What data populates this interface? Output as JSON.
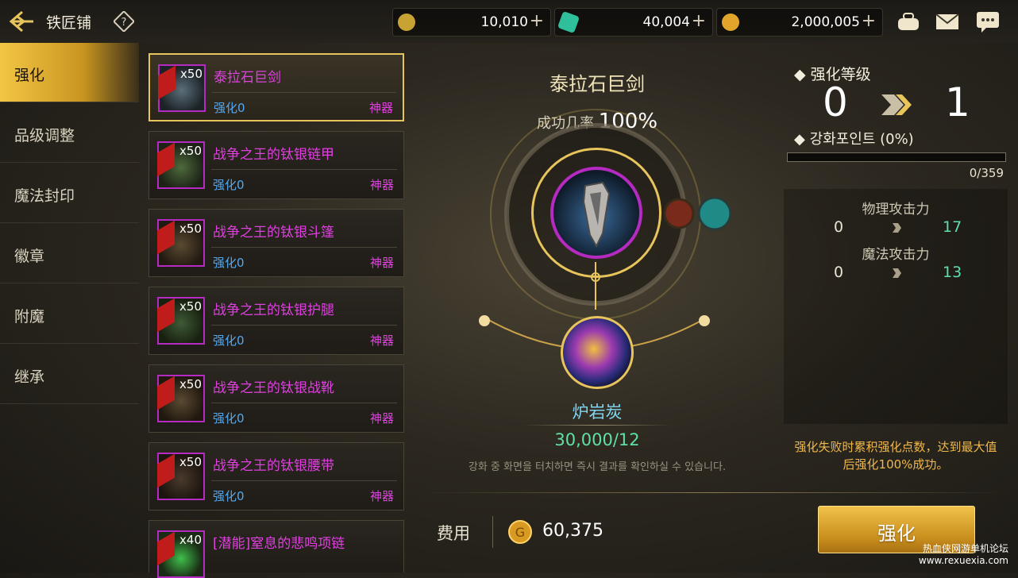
{
  "header": {
    "title": "铁匠铺",
    "resources": [
      {
        "name": "c-token",
        "value": "10,010"
      },
      {
        "name": "crystal",
        "value": "40,004"
      },
      {
        "name": "gold",
        "value": "2,000,005"
      }
    ]
  },
  "menu": {
    "items": [
      {
        "label": "强化",
        "active": true
      },
      {
        "label": "品级调整",
        "active": false
      },
      {
        "label": "魔法封印",
        "active": false
      },
      {
        "label": "徽章",
        "active": false
      },
      {
        "label": "附魔",
        "active": false
      },
      {
        "label": "继承",
        "active": false
      }
    ]
  },
  "items": [
    {
      "name": "泰拉石巨剑",
      "level": "强化0",
      "grade": "神器",
      "qty": "x50",
      "selected": true
    },
    {
      "name": "战争之王的钛银链甲",
      "level": "强化0",
      "grade": "神器",
      "qty": "x50",
      "selected": false
    },
    {
      "name": "战争之王的钛银斗篷",
      "level": "强化0",
      "grade": "神器",
      "qty": "x50",
      "selected": false
    },
    {
      "name": "战争之王的钛银护腿",
      "level": "强化0",
      "grade": "神器",
      "qty": "x50",
      "selected": false
    },
    {
      "name": "战争之王的钛银战靴",
      "level": "强化0",
      "grade": "神器",
      "qty": "x50",
      "selected": false
    },
    {
      "name": "战争之王的钛银腰带",
      "level": "强化0",
      "grade": "神器",
      "qty": "x50",
      "selected": false
    },
    {
      "name": "[潜能]窒息的悲鸣项链",
      "level": "",
      "grade": "",
      "qty": "x40",
      "selected": false
    }
  ],
  "center": {
    "item_name": "泰拉石巨剑",
    "rate_label": "成功几率",
    "rate_value": "100%",
    "material_name": "炉岩炭",
    "material_count": "30,000/12",
    "hint": "강화 중 화면을 터치하면 즉시 결과를 확인하실 수 있습니다."
  },
  "right": {
    "level_label": "强化等级",
    "level_from": "0",
    "level_to": "1",
    "points_label": "강화포인트 (0%)",
    "points_progress": 0,
    "points_value": "0/359",
    "stats": [
      {
        "name": "物理攻击力",
        "current": "0",
        "next": "17"
      },
      {
        "name": "魔法攻击力",
        "current": "0",
        "next": "13"
      }
    ],
    "note_line1": "强化失败时累积强化点数，达到最大值",
    "note_line2": "后强化100%成功。"
  },
  "bottom": {
    "cost_label": "费用",
    "cost_value": "60,375",
    "button_label": "强化"
  },
  "watermark": {
    "line1": "热血侠网游单机论坛",
    "line2": "www.rexuexia.com"
  },
  "colors": {
    "accent_gold": "#e8c45c",
    "artifact_purple": "#e040e0",
    "level_blue": "#54a8f0",
    "green": "#5fe0a8"
  }
}
